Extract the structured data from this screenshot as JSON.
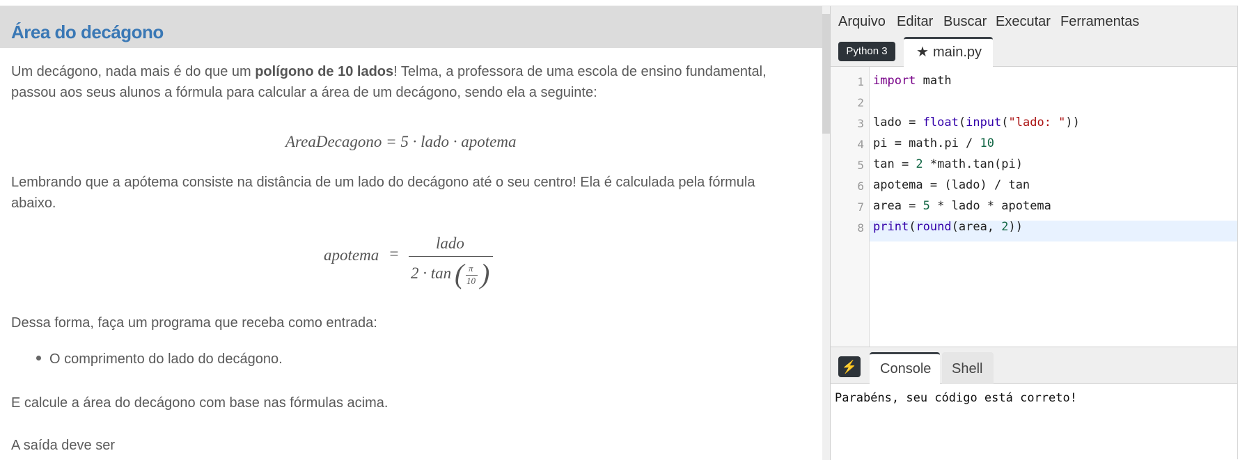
{
  "problem": {
    "title": "Área do decágono",
    "p1_part1": "Um decágono, nada mais é do que um ",
    "p1_bold": "polígono de 10 lados",
    "p1_part2": "! Telma, a professora de uma escola de ensino fundamental,",
    "p1_line2": "passou aos seus alunos a fórmula para calcular a área de um decágono, sendo ela a seguinte:",
    "formula1": "AreaDecagono = 5 · lado · apotema",
    "p2_line1": "Lembrando que a apótema consiste na distância de um lado do decágono até o seu centro! Ela é calculada pela fórmula",
    "p2_line2": "abaixo.",
    "formula2_lhs": "apotema",
    "formula2_eq": "=",
    "formula2_num": "lado",
    "formula2_den_prefix": "2 · tan",
    "formula2_pi": "π",
    "formula2_ten": "10",
    "p3": "Dessa forma, faça um programa que receba como entrada:",
    "bullet1": "O comprimento do lado do decágono.",
    "p4": "E calcule a área do decágono com base nas fórmulas acima.",
    "p5": "A saída deve ser"
  },
  "ide": {
    "menu": [
      "Arquivo",
      "Editar",
      "Buscar",
      "Executar",
      "Ferramentas"
    ],
    "language_badge": "Python 3",
    "file_tab": "main.py",
    "line_numbers": [
      "1",
      "2",
      "3",
      "4",
      "5",
      "6",
      "7",
      "8"
    ],
    "code": [
      "import math",
      "",
      "lado = float(input(\"lado: \"))",
      "pi = math.pi / 10",
      "tan = 2 *math.tan(pi)",
      "apotema = (lado) / tan",
      "area = 5 * lado * apotema",
      "print(round(area, 2))"
    ],
    "console_tab": "Console",
    "shell_tab": "Shell",
    "console_output": "Parabéns, seu código está correto!"
  },
  "colors": {
    "title": "#3a78b5",
    "keyword": "#770088",
    "builtin": "#3300aa",
    "string": "#aa1111",
    "number": "#116644",
    "badge_bg": "#2d3339"
  },
  "icons": {
    "file_tab": "star-icon",
    "run": "lightning-icon"
  }
}
